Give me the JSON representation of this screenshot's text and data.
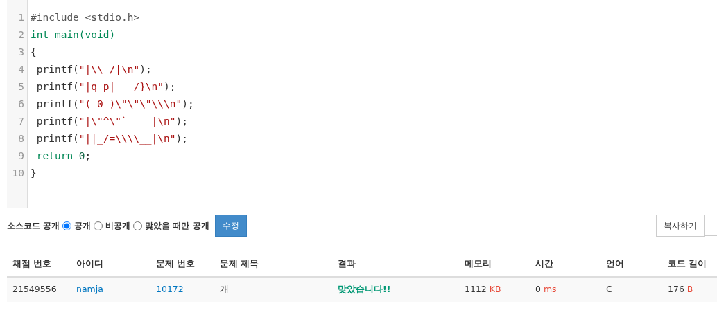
{
  "code_lines": [
    [
      {
        "text": "#include <stdio.h>",
        "kind": "meta"
      }
    ],
    [
      {
        "text": "int",
        "kind": "keyword"
      },
      {
        "text": " main(void)",
        "kind": "def"
      }
    ],
    [
      {
        "text": "{",
        "kind": "plain"
      }
    ],
    [
      {
        "text": " printf(",
        "kind": "plain"
      },
      {
        "text": "\"|\\\\_/|\\n\"",
        "kind": "string"
      },
      {
        "text": ");",
        "kind": "plain"
      }
    ],
    [
      {
        "text": " printf(",
        "kind": "plain"
      },
      {
        "text": "\"|q p|   /}\\n\"",
        "kind": "string"
      },
      {
        "text": ");",
        "kind": "plain"
      }
    ],
    [
      {
        "text": " printf(",
        "kind": "plain"
      },
      {
        "text": "\"( 0 )\\\"\\\"\\\"\\\\\\n\"",
        "kind": "string"
      },
      {
        "text": ");",
        "kind": "plain"
      }
    ],
    [
      {
        "text": " printf(",
        "kind": "plain"
      },
      {
        "text": "\"|\\\"^\\\"`    |\\n\"",
        "kind": "string"
      },
      {
        "text": ");",
        "kind": "plain"
      }
    ],
    [
      {
        "text": " printf(",
        "kind": "plain"
      },
      {
        "text": "\"||_/=\\\\\\\\__|\\n\"",
        "kind": "string"
      },
      {
        "text": ");",
        "kind": "plain"
      }
    ],
    [
      {
        "text": " return",
        "kind": "keyword"
      },
      {
        "text": " 0",
        "kind": "number"
      },
      {
        "text": ";",
        "kind": "plain"
      }
    ],
    [
      {
        "text": "}",
        "kind": "plain"
      }
    ]
  ],
  "line_numbers": [
    "1",
    "2",
    "3",
    "4",
    "5",
    "6",
    "7",
    "8",
    "9",
    "10"
  ],
  "visibility": {
    "label": "소스코드 공개",
    "options": [
      {
        "label": "공개",
        "selected": true
      },
      {
        "label": "비공개",
        "selected": false
      },
      {
        "label": "맞았을 때만 공개",
        "selected": false
      }
    ],
    "submit": "수정"
  },
  "copy_button": "복사하기",
  "table": {
    "columns": [
      "채점 번호",
      "아이디",
      "문제 번호",
      "문제 제목",
      "결과",
      "메모리",
      "시간",
      "언어",
      "코드 길이"
    ],
    "rows": [
      {
        "submission_id": "21549556",
        "user": "namja",
        "problem_id": "10172",
        "problem_title": "개",
        "result": "맞았습니다!!",
        "memory": "1112",
        "memory_unit": "KB",
        "time": "0",
        "time_unit": "ms",
        "language": "C",
        "code_length": "176",
        "code_length_unit": "B"
      }
    ]
  }
}
